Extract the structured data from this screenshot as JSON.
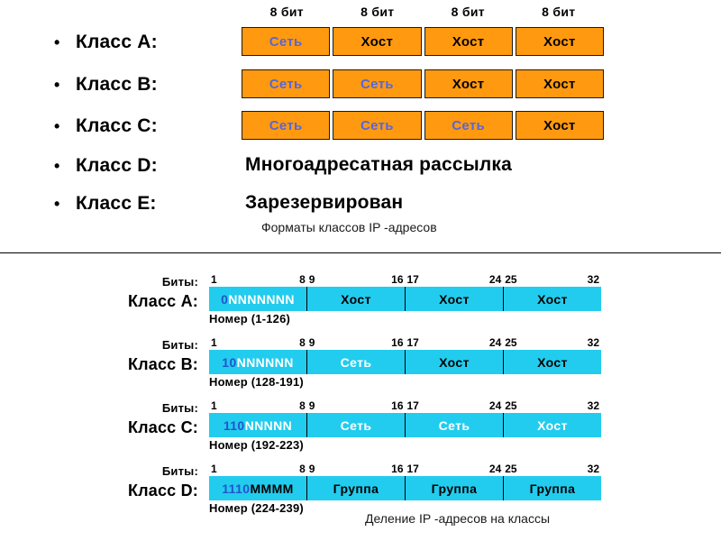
{
  "top": {
    "bit_widths": [
      "8 бит",
      "8 бит",
      "8 бит",
      "8 бит"
    ],
    "rows": [
      {
        "label": "Класс A:",
        "type": "bar",
        "segments": [
          {
            "text": "Сеть",
            "kind": "net"
          },
          {
            "text": "Хост",
            "kind": "host"
          },
          {
            "text": "Хост",
            "kind": "host"
          },
          {
            "text": "Хост",
            "kind": "host"
          }
        ]
      },
      {
        "label": "Класс B:",
        "type": "bar",
        "segments": [
          {
            "text": "Сеть",
            "kind": "net"
          },
          {
            "text": "Сеть",
            "kind": "net"
          },
          {
            "text": "Хост",
            "kind": "host"
          },
          {
            "text": "Хост",
            "kind": "host"
          }
        ]
      },
      {
        "label": "Класс C:",
        "type": "bar",
        "segments": [
          {
            "text": "Сеть",
            "kind": "net"
          },
          {
            "text": "Сеть",
            "kind": "net"
          },
          {
            "text": "Сеть",
            "kind": "net"
          },
          {
            "text": "Хост",
            "kind": "host"
          }
        ]
      },
      {
        "label": "Класс D:",
        "type": "text",
        "value": "Многоадресатная рассылка"
      },
      {
        "label": "Класс E:",
        "type": "text",
        "value": "Зарезервирован"
      }
    ],
    "caption": "Форматы классов IP -адресов"
  },
  "bottom": {
    "bits_label": "Биты:",
    "ruler_marks": [
      {
        "start": "1",
        "end": "8"
      },
      {
        "start": "9",
        "end": "16"
      },
      {
        "start": "17",
        "end": "24"
      },
      {
        "start": "25",
        "end": "32"
      }
    ],
    "rows": [
      {
        "label": "Класс A:",
        "prefix": "0",
        "prefix_rest": "NNNNNNN",
        "segments": [
          {
            "text": "Хост",
            "kind": "black"
          },
          {
            "text": "Хост",
            "kind": "black"
          },
          {
            "text": "Хост",
            "kind": "black"
          }
        ],
        "nomer": "Номер (1-126)"
      },
      {
        "label": "Класс B:",
        "prefix": "10",
        "prefix_rest": "NNNNNN",
        "segments": [
          {
            "text": "Сеть",
            "kind": "white"
          },
          {
            "text": "Хост",
            "kind": "black"
          },
          {
            "text": "Хост",
            "kind": "black"
          }
        ],
        "nomer": "Номер (128-191)"
      },
      {
        "label": "Класс C:",
        "prefix": "110",
        "prefix_rest": "NNNNN",
        "segments": [
          {
            "text": "Сеть",
            "kind": "white"
          },
          {
            "text": "Сеть",
            "kind": "white"
          },
          {
            "text": "Хост",
            "kind": "white"
          }
        ],
        "nomer": "Номер (192-223)"
      },
      {
        "label": "Класс D:",
        "prefix": "1110",
        "prefix_rest": "MMMM",
        "segments": [
          {
            "text": "Группа",
            "kind": "black"
          },
          {
            "text": "Группа",
            "kind": "black"
          },
          {
            "text": "Группа",
            "kind": "black"
          }
        ],
        "nomer": "Номер (224-239)"
      }
    ],
    "caption": "Деление IP -адресов на классы"
  },
  "colors": {
    "orange": "#FF9A10",
    "cyan": "#22CCEE",
    "net_text": "#5566DD",
    "prefix_text": "#2255CC"
  }
}
